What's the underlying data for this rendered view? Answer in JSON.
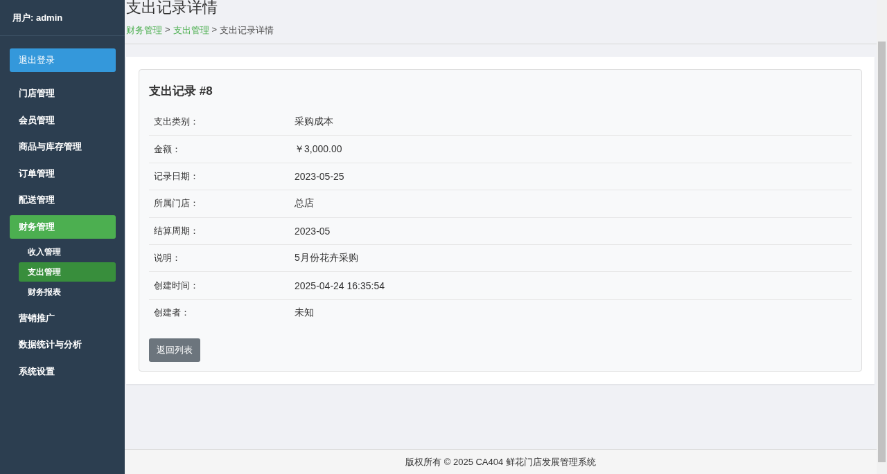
{
  "sidebar": {
    "user": "用户: admin",
    "logout": "退出登录",
    "items": [
      {
        "label": "门店管理",
        "selected": false
      },
      {
        "label": "会员管理",
        "selected": false
      },
      {
        "label": "商品与库存管理",
        "selected": false
      },
      {
        "label": "订单管理",
        "selected": false
      },
      {
        "label": "配送管理",
        "selected": false
      },
      {
        "label": "财务管理",
        "selected": true,
        "expanded": true,
        "children": [
          {
            "label": "收入管理",
            "selected": false
          },
          {
            "label": "支出管理",
            "selected": true
          },
          {
            "label": "财务报表",
            "selected": false
          }
        ]
      },
      {
        "label": "营销推广",
        "selected": false
      },
      {
        "label": "数据统计与分析",
        "selected": false
      },
      {
        "label": "系统设置",
        "selected": false
      }
    ]
  },
  "page": {
    "title": "支出记录详情",
    "breadcrumb": [
      {
        "label": "财务管理",
        "link": true
      },
      {
        "label": "支出管理",
        "link": true
      },
      {
        "label": "支出记录详情",
        "link": false
      }
    ],
    "separator": ">"
  },
  "record": {
    "title": "支出记录 #8",
    "fields": [
      {
        "label": "支出类别：",
        "value": "采购成本"
      },
      {
        "label": "金额：",
        "value": "￥3,000.00"
      },
      {
        "label": "记录日期：",
        "value": "2023-05-25"
      },
      {
        "label": "所属门店：",
        "value": "总店"
      },
      {
        "label": "结算周期：",
        "value": "2023-05"
      },
      {
        "label": "说明：",
        "value": "5月份花卉采购"
      },
      {
        "label": "创建时间：",
        "value": "2025-04-24 16:35:54"
      },
      {
        "label": "创建者：",
        "value": "未知"
      }
    ],
    "back_button": "返回列表"
  },
  "footer": "版权所有 © 2025 CA404 鲜花门店发展管理系统"
}
